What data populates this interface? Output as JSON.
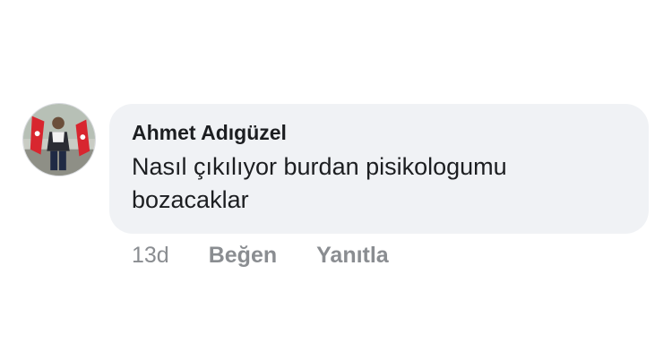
{
  "comment": {
    "author": "Ahmet Adıgüzel",
    "text_line1": "Nasıl çıkılıyor burdan pisikologumu",
    "text_line2": "bozacaklar",
    "avatar_icon": "user-avatar-photo"
  },
  "actions": {
    "timestamp": "13d",
    "like_label": "Beğen",
    "reply_label": "Yanıtla"
  },
  "colors": {
    "bubble_bg": "#f0f2f5",
    "text": "#1c1e21",
    "secondary": "#8a8d91"
  }
}
